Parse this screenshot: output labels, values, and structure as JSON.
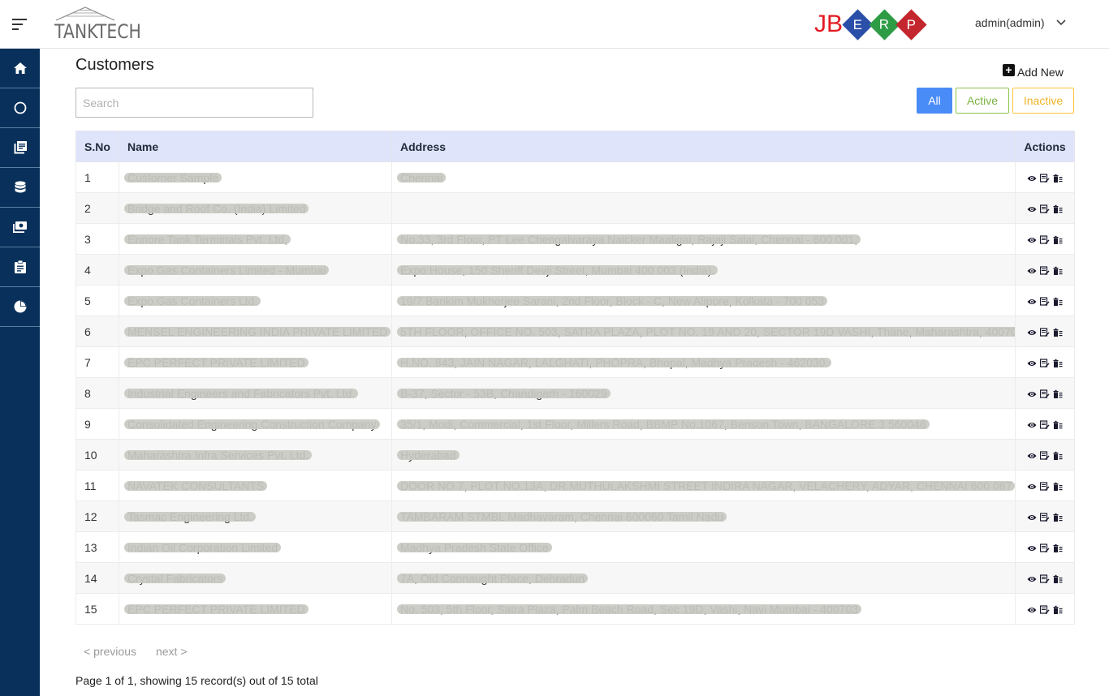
{
  "header": {
    "brand": "TANKTECH",
    "erp_logo": {
      "prefix": "JB",
      "letters": [
        {
          "letter": "E",
          "color": "#2b4fa8"
        },
        {
          "letter": "R",
          "color": "#2e9b45"
        },
        {
          "letter": "P",
          "color": "#c4262e"
        }
      ]
    },
    "user": "admin(admin)"
  },
  "sidebar": {
    "items": [
      {
        "icon": "home-icon"
      },
      {
        "icon": "circle-icon"
      },
      {
        "icon": "library-books-icon"
      },
      {
        "icon": "database-icon"
      },
      {
        "icon": "money-icon"
      },
      {
        "icon": "clipboard-icon"
      },
      {
        "icon": "pie-chart-icon"
      }
    ]
  },
  "page": {
    "title": "Customers",
    "add_new": "Add New",
    "search_placeholder": "Search",
    "filters": {
      "all": "All",
      "active": "Active",
      "inactive": "Inactive"
    }
  },
  "table": {
    "headers": {
      "sno": "S.No",
      "name": "Name",
      "address": "Address",
      "actions": "Actions"
    },
    "rows": [
      {
        "sno": "1",
        "name": "Customer Sample",
        "address": "Chennai"
      },
      {
        "sno": "2",
        "name": "Bridge and Roof Co. (India) Limited",
        "address": ""
      },
      {
        "sno": "3",
        "name": "Ennore Tank Terminals Pvt. Ltd,",
        "address": "No.33, 3rd Floor, PT Lee Chengalvaraya Naicker Maaligai, Rajaji Salai, Chennai - 600 001,"
      },
      {
        "sno": "4",
        "name": "Expo Gas Containers Limited - Mumbai",
        "address": "Expo House, 150 Sheriff Devji Street, Mumbai 400 003 (India)."
      },
      {
        "sno": "5",
        "name": "Expo Gas Containers Ltd.",
        "address": "19/7 Bankim Mukherjee Sarani, 2nd Floor, Block - C, New Alipore, Kolkata - 700 053"
      },
      {
        "sno": "6",
        "name": "MENSEL ENGINEERING INDIA PRIVATE LIMITED",
        "address": "5TH FLOOR, OFFICE NO. 503, SATRA PLAZA, PLOT NO. 19 AND 20, SECTOR 19D VASHI, Thane, Maharashtra, 400703."
      },
      {
        "sno": "7",
        "name": "EPC PERFECT PRIVATE LIMITED",
        "address": "H.NO. 843, JAIN NAGAR, LALGHATI, PHOPRA, Bhopal, Madhya Pradesh - 462030."
      },
      {
        "sno": "8",
        "name": "Industrial Engineers and Fabricators Pvt. Ltd.",
        "address": "B-37, Sector - 53B, Chandigarh - 160029"
      },
      {
        "sno": "9",
        "name": "Consolidated Engineering Construction Company",
        "address": "35/1, Modi, Commercial, 1st Floor, Millers Road, BBMP No.1067, Benson Town, BANGALORE 3 560046"
      },
      {
        "sno": "10",
        "name": "Maharashtra Infra Services Pvt. Ltd.",
        "address": "Hyderabad"
      },
      {
        "sno": "11",
        "name": "NAVATEK CONSULTANTS",
        "address": "DOOR NO.7, PLOT NO.13A, DR.MUTHULAKSHMI STREET INDIRA NAGAR, VELACHERY, ADYAR, CHENNAI 600 087"
      },
      {
        "sno": "12",
        "name": "Tasmac Engineering Ltd.",
        "address": "TAMBARAM STMBL Madhavaram, Chennai 600060 Tamil Nadu"
      },
      {
        "sno": "13",
        "name": "Indian Oil Corporation Limited",
        "address": "Madhya Pradesh State Office"
      },
      {
        "sno": "14",
        "name": "Crystal Fabricators",
        "address": "7A, Old Connaught Place, Dehradun"
      },
      {
        "sno": "15",
        "name": "EPC PERFECT PRIVATE LIMITED",
        "address": "No. 503, 5th Floor, Satra Plaza, Palm Beach Road, Sec 19D, Vashi, Navi Mumbai - 400703"
      }
    ]
  },
  "pagination": {
    "previous": "< previous",
    "next": "next >",
    "info": "Page 1 of 1, showing 15 record(s) out of 15 total"
  }
}
